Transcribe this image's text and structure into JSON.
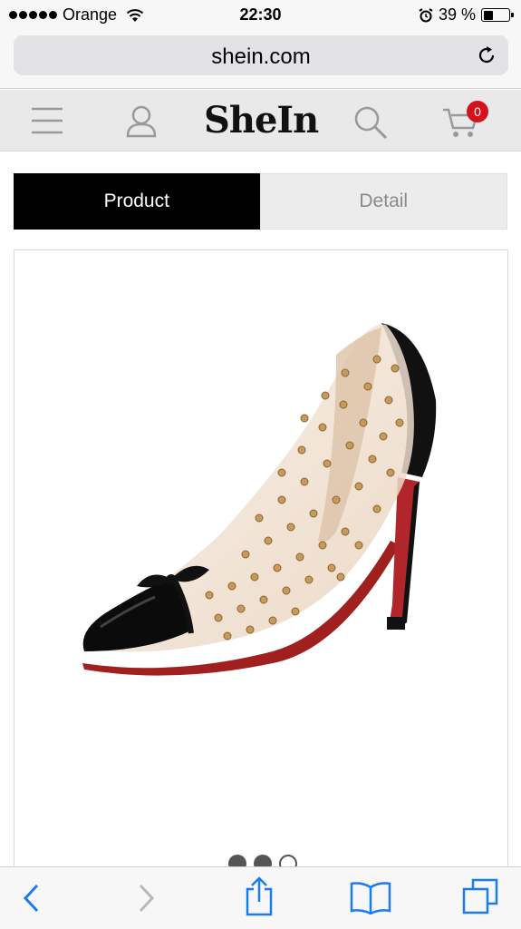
{
  "status": {
    "carrier": "Orange",
    "time": "22:30",
    "battery_percent": "39 %",
    "battery_level": 0.39
  },
  "browser": {
    "url": "shein.com"
  },
  "header": {
    "logo": "SheIn",
    "cart_count": "0",
    "accent": "#d4121c"
  },
  "tabs": [
    {
      "label": "Product",
      "active": true
    },
    {
      "label": "Detail",
      "active": false
    }
  ],
  "gallery": {
    "image": "studded-clear-pump-heel",
    "total_images": 3,
    "current_index": 2
  },
  "toolbar": {
    "icons": [
      "back-icon",
      "forward-icon",
      "share-icon",
      "bookmarks-icon",
      "tabs-icon"
    ]
  }
}
